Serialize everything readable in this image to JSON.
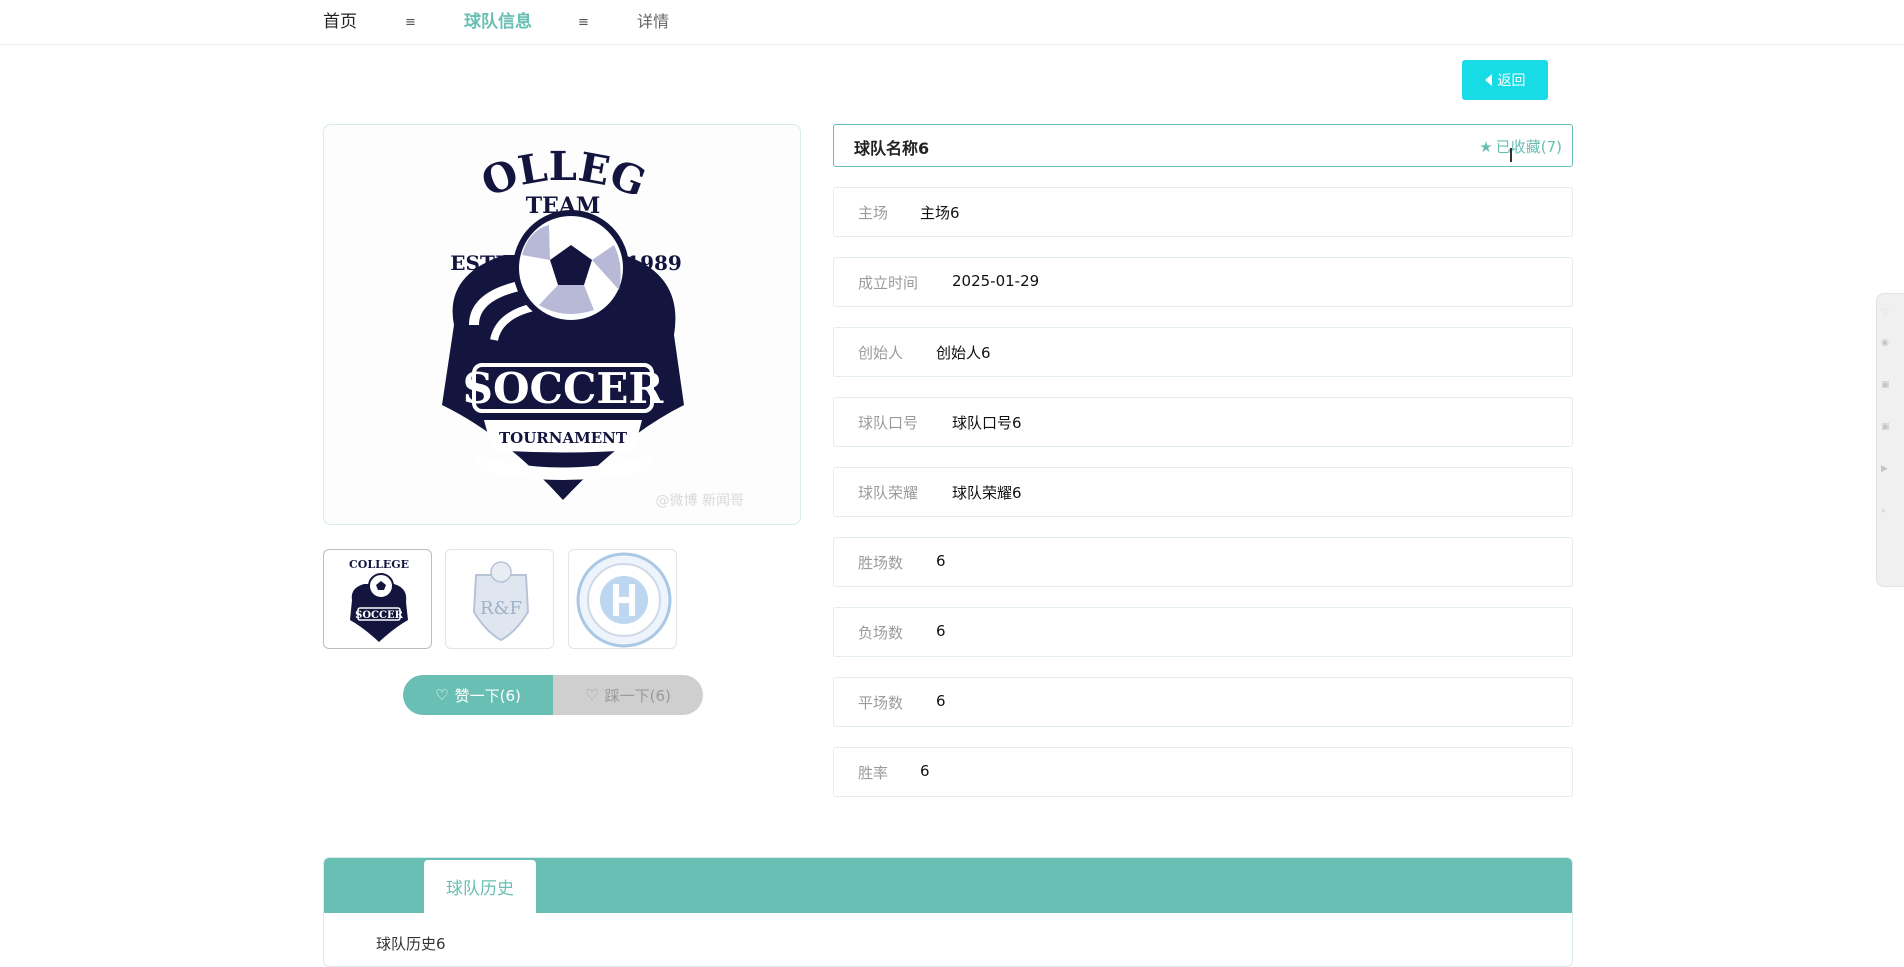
{
  "breadcrumb": {
    "home": "首页",
    "separator": "≡",
    "team_info": "球队信息",
    "detail": "详情"
  },
  "back_button": {
    "label": "返回"
  },
  "team": {
    "name": "球队名称6",
    "collect_label": "已收藏(7)"
  },
  "fields": [
    {
      "label": "主场",
      "value": "主场6"
    },
    {
      "label": "成立时间",
      "value": "2025-01-29"
    },
    {
      "label": "创始人",
      "value": "创始人6"
    },
    {
      "label": "球队口号",
      "value": "球队口号6"
    },
    {
      "label": "球队荣耀",
      "value": "球队荣耀6"
    },
    {
      "label": "胜场数",
      "value": "6"
    },
    {
      "label": "负场数",
      "value": "6"
    },
    {
      "label": "平场数",
      "value": "6"
    },
    {
      "label": "胜率",
      "value": "6"
    }
  ],
  "logo": {
    "line1": "COLLEGE",
    "line2": "TEAM",
    "estb": "ESTB",
    "year": "1989",
    "soccer": "SOCCER",
    "tournament": "TOURNAMENT",
    "watermark": "@微博 新闻哥"
  },
  "thumbs": [
    {
      "name": "college-team-soccer"
    },
    {
      "name": "rf-crest",
      "text": "R&F"
    },
    {
      "name": "round-crest"
    }
  ],
  "votes": {
    "like": "赞一下(6)",
    "dislike": "踩一下(6)"
  },
  "tabs": [
    {
      "label": "球队历史",
      "content": "球队历史6"
    }
  ],
  "colors": {
    "accent": "#69bfb3",
    "button_cyan": "#17dce6",
    "logo_navy": "#14153f"
  }
}
